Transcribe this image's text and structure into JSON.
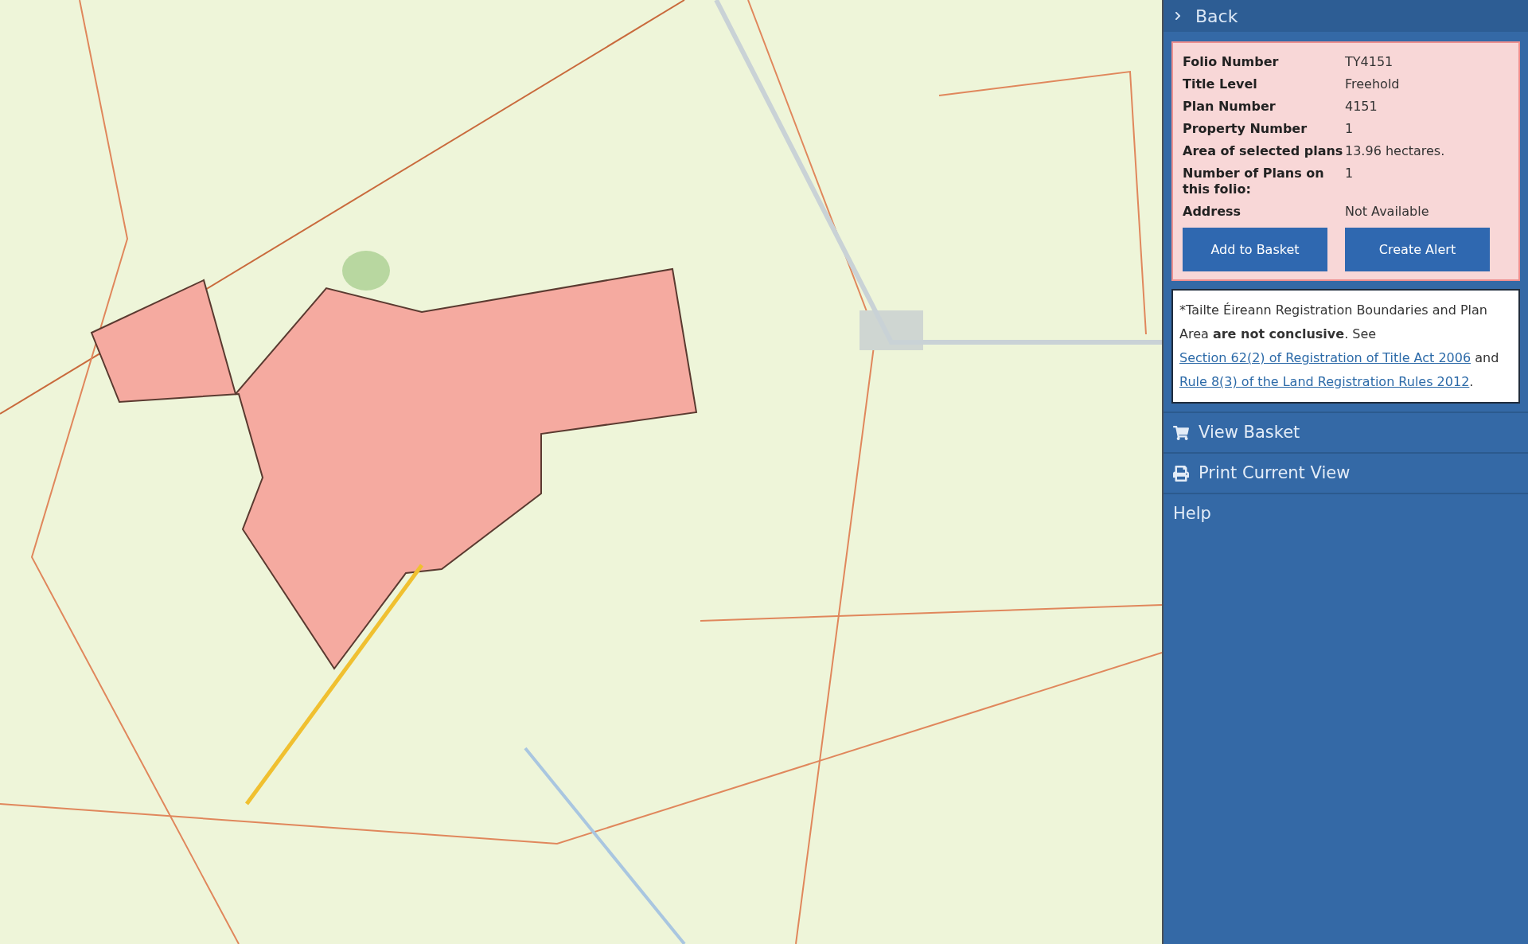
{
  "sidebar": {
    "back": {
      "label": "Back"
    },
    "details": [
      {
        "label": "Folio Number",
        "value": "TY4151"
      },
      {
        "label": "Title Level",
        "value": "Freehold"
      },
      {
        "label": "Plan Number",
        "value": "4151"
      },
      {
        "label": "Property Number",
        "value": "1"
      },
      {
        "label": "Area of selected plans",
        "value": "13.96 hectares."
      },
      {
        "label": "Number of Plans on this folio:",
        "value": "1"
      },
      {
        "label": "Address",
        "value": "Not Available"
      }
    ],
    "buttons": [
      "Add to Basket",
      "Create Alert"
    ],
    "notice": [
      {
        "kind": "text",
        "text": "*Tailte Éireann Registration Boundaries and Plan Area **are not conclusive**. See "
      },
      {
        "kind": "link",
        "text": "Section 62(2) of Registration of Title Act 2006"
      },
      {
        "kind": "text",
        "text": " and "
      },
      {
        "kind": "link",
        "text": "Rule 8(3) of the Land Registration Rules 2012"
      },
      {
        "kind": "text",
        "text": "."
      }
    ],
    "menu": [
      {
        "kind": "cart",
        "label": "View Basket"
      },
      {
        "kind": "print",
        "label": "Print Current View"
      },
      {
        "kind": "plain",
        "label": "Help"
      }
    ]
  }
}
